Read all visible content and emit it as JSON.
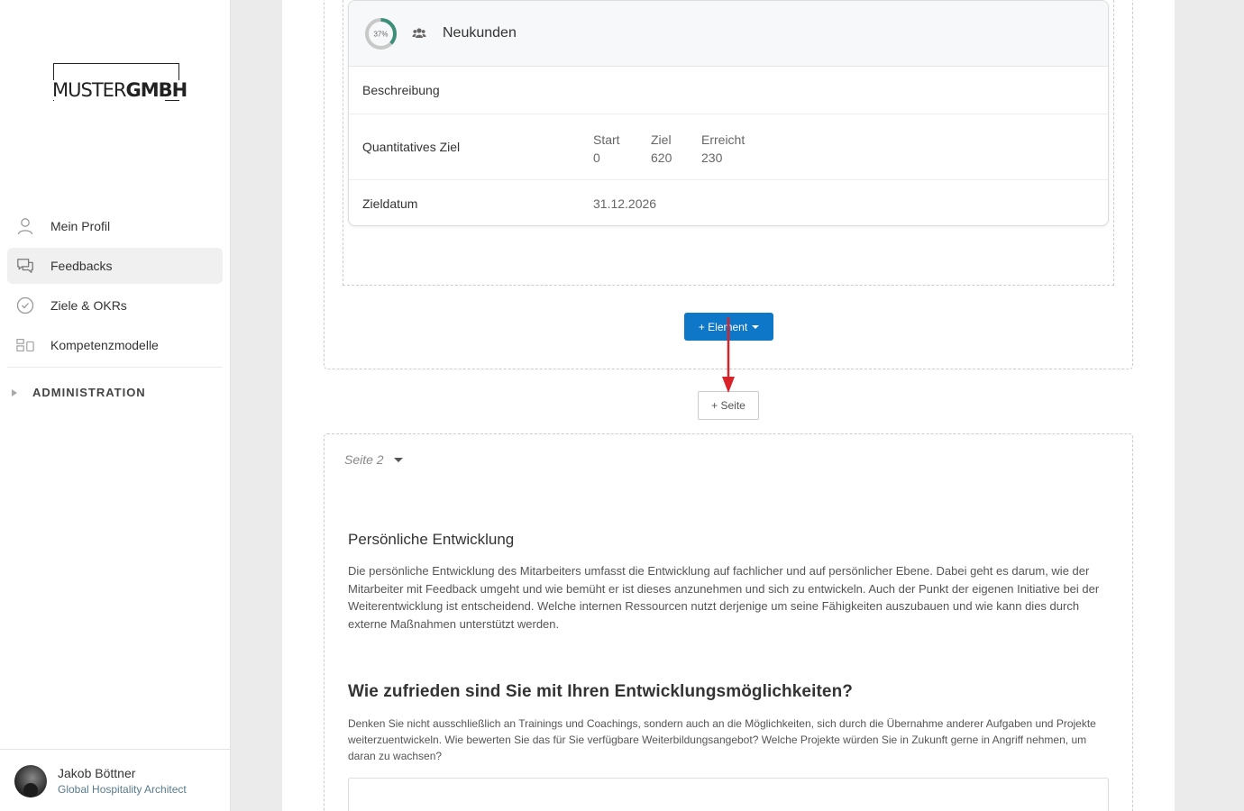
{
  "brand": {
    "logo_light": "MUSTER",
    "logo_bold": "GMBH"
  },
  "sidebar": {
    "items": [
      {
        "label": "Mein Profil",
        "icon": "user-icon",
        "active": false
      },
      {
        "label": "Feedbacks",
        "icon": "chat-icon",
        "active": true
      },
      {
        "label": "Ziele & OKRs",
        "icon": "check-circle-icon",
        "active": false
      },
      {
        "label": "Kompetenzmodelle",
        "icon": "model-icon",
        "active": false
      }
    ],
    "admin_label": "ADMINISTRATION"
  },
  "user": {
    "name": "Jakob Böttner",
    "role": "Global Hospitality Architect"
  },
  "goal_card": {
    "progress_label": "37%",
    "progress_fraction": 0.37,
    "title": "Neukunden",
    "description_label": "Beschreibung",
    "quant_label": "Quantitatives Ziel",
    "start_label": "Start",
    "start_value": "0",
    "target_label": "Ziel",
    "target_value": "620",
    "reached_label": "Erreicht",
    "reached_value": "230",
    "date_label": "Zieldatum",
    "date_value": "31.12.2026"
  },
  "buttons": {
    "add_element": "+ Element",
    "add_page": "+ Seite"
  },
  "page2": {
    "label": "Seite 2",
    "section_title": "Persönliche Entwicklung",
    "section_text": "Die persönliche Entwicklung des Mitarbeiters umfasst die Entwicklung auf fachlicher und auf persönlicher Ebene. Dabei geht es darum, wie der Mitarbeiter mit Feedback umgeht und wie bemüht er ist dieses anzunehmen und sich zu entwickeln. Auch der Punkt der eigenen Initiative bei der Weiterentwicklung ist entscheidend. Welche internen Ressourcen nutzt derjenige um seine Fähigkeiten auszubauen und wie kann dies durch externe Maßnahmen unterstützt werden.",
    "question": "Wie zufrieden sind Sie mit Ihren Entwicklungsmöglichkeiten?",
    "question_text": "Denken Sie nicht ausschließlich an Trainings und Coachings, sondern auch an die Möglichkeiten, sich durch die Übernahme anderer Aufgaben und Projekte weiterzuentwickeln. Wie bewerten Sie das für Sie verfügbare Weiterbildungsangebot? Welche Projekte würden Sie in Zukunft gerne in Angriff nehmen, um daran zu wachsen?"
  },
  "colors": {
    "primary": "#0f77c7",
    "progress": "#3d8f7a",
    "arrow": "#d9232a"
  }
}
